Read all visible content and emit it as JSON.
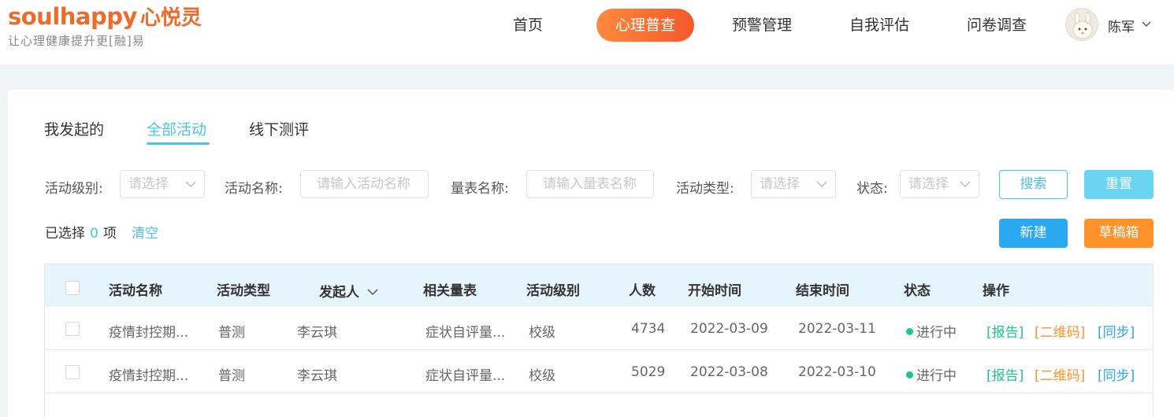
{
  "header": {
    "logo_en": "soulhappy",
    "logo_cn": "心悦灵",
    "slogan": "让心理健康提升更[融]易",
    "nav": [
      {
        "label": "首页",
        "active": false
      },
      {
        "label": "心理普查",
        "active": true
      },
      {
        "label": "预警管理",
        "active": false
      },
      {
        "label": "自我评估",
        "active": false
      },
      {
        "label": "问卷调查",
        "active": false
      }
    ],
    "user_name": "陈军"
  },
  "tabs": [
    {
      "label": "我发起的",
      "active": false
    },
    {
      "label": "全部活动",
      "active": true
    },
    {
      "label": "线下测评",
      "active": false
    }
  ],
  "filters": {
    "level_label": "活动级别:",
    "level_placeholder": "请选择",
    "name_label": "活动名称:",
    "name_placeholder": "请输入活动名称",
    "scale_label": "量表名称:",
    "scale_placeholder": "请输入量表名称",
    "type_label": "活动类型:",
    "type_placeholder": "请选择",
    "status_label": "状态:",
    "status_placeholder": "请选择",
    "search_label": "搜索",
    "reset_label": "重置"
  },
  "selection": {
    "prefix": "已选择",
    "count": "0",
    "suffix": "项",
    "clear_label": "清空"
  },
  "actions": {
    "new_label": "新建",
    "draft_label": "草稿箱"
  },
  "table": {
    "columns": [
      "活动名称",
      "活动类型",
      "发起人",
      "相关量表",
      "活动级别",
      "人数",
      "开始时间",
      "结束时间",
      "状态",
      "操作"
    ],
    "rows": [
      {
        "name": "疫情封控期...",
        "type": "普测",
        "initiator": "李云琪",
        "scale": "症状自评量...",
        "level": "校级",
        "count": "4734",
        "start": "2022-03-09",
        "end": "2022-03-11",
        "status": "进行中",
        "op_report": "[报告]",
        "op_qr": "[二维码]",
        "op_sync": "[同步]"
      },
      {
        "name": "疫情封控期...",
        "type": "普测",
        "initiator": "李云琪",
        "scale": "症状自评量...",
        "level": "校级",
        "count": "5029",
        "start": "2022-03-08",
        "end": "2022-03-10",
        "status": "进行中",
        "op_report": "[报告]",
        "op_qr": "[二维码]",
        "op_sync": "[同步]"
      }
    ]
  },
  "colors": {
    "brand": "#f06a2a",
    "accent": "#4cc3e8",
    "status_active": "#1cc78e",
    "draft": "#ff922b",
    "new": "#2aa8f0"
  }
}
